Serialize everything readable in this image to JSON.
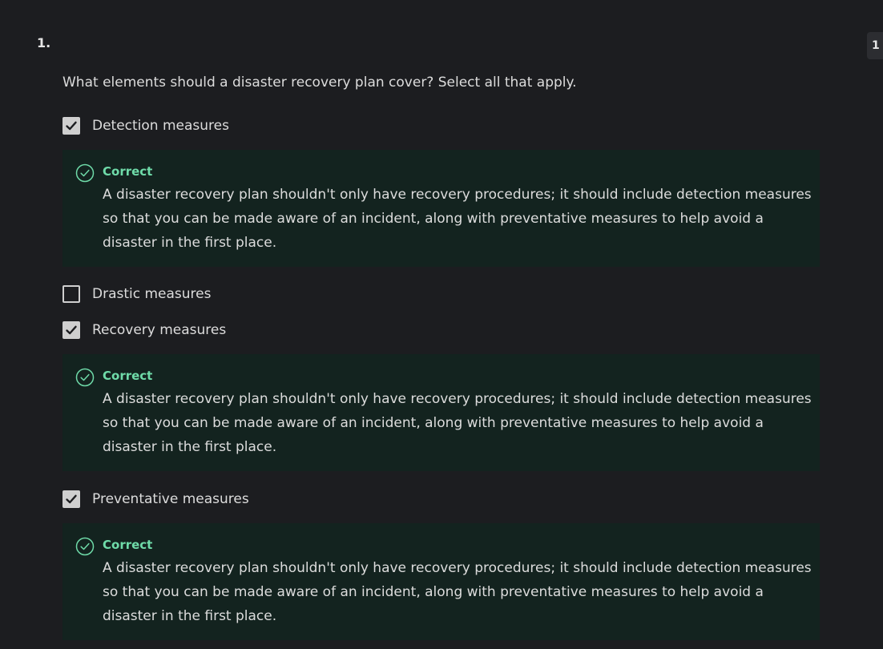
{
  "question": {
    "number": "1.",
    "score_badge": "1 /",
    "prompt": "What elements should a disaster recovery plan cover? Select all that apply."
  },
  "options": [
    {
      "label": "Detection measures",
      "checked": true,
      "feedback": {
        "status": "Correct",
        "text": "A disaster recovery plan shouldn't only have recovery procedures; it should include detection measures so that you can be made aware of an incident, along with preventative measures to help avoid a disaster in the first place."
      }
    },
    {
      "label": "Drastic measures",
      "checked": false
    },
    {
      "label": "Recovery measures",
      "checked": true,
      "feedback": {
        "status": "Correct",
        "text": "A disaster recovery plan shouldn't only have recovery procedures; it should include detection measures so that you can be made aware of an incident, along with preventative measures to help avoid a disaster in the first place."
      }
    },
    {
      "label": "Preventative measures",
      "checked": true,
      "feedback": {
        "status": "Correct",
        "text": "A disaster recovery plan shouldn't only have recovery procedures; it should include detection measures so that you can be made aware of an incident, along with preventative measures to help avoid a disaster in the first place."
      }
    }
  ],
  "icons": {
    "checkbox_checked": "checkmark-icon",
    "feedback_correct": "check-circle-icon"
  },
  "colors": {
    "background": "#1c1d20",
    "feedback_background": "#13231f",
    "correct_accent": "#6fdba9",
    "checkbox": "#cfcfcf"
  }
}
